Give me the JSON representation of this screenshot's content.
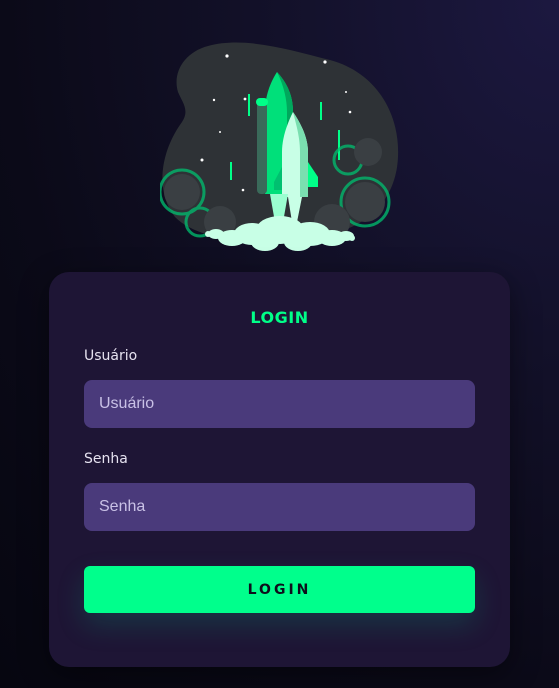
{
  "illustration": {
    "icon": "rocket-launch-illustration",
    "colors": {
      "blob": "#2e3236",
      "rocket": "#00ff88",
      "smoke": "#c8ffe6"
    }
  },
  "card": {
    "title": "LOGIN",
    "username": {
      "label": "Usuário",
      "placeholder": "Usuário",
      "value": ""
    },
    "password": {
      "label": "Senha",
      "placeholder": "Senha",
      "value": ""
    },
    "submit_label": "LOGIN"
  },
  "colors": {
    "accent": "#00ff88",
    "card_bg": "#1e1535",
    "input_bg": "#4a3a7b"
  }
}
